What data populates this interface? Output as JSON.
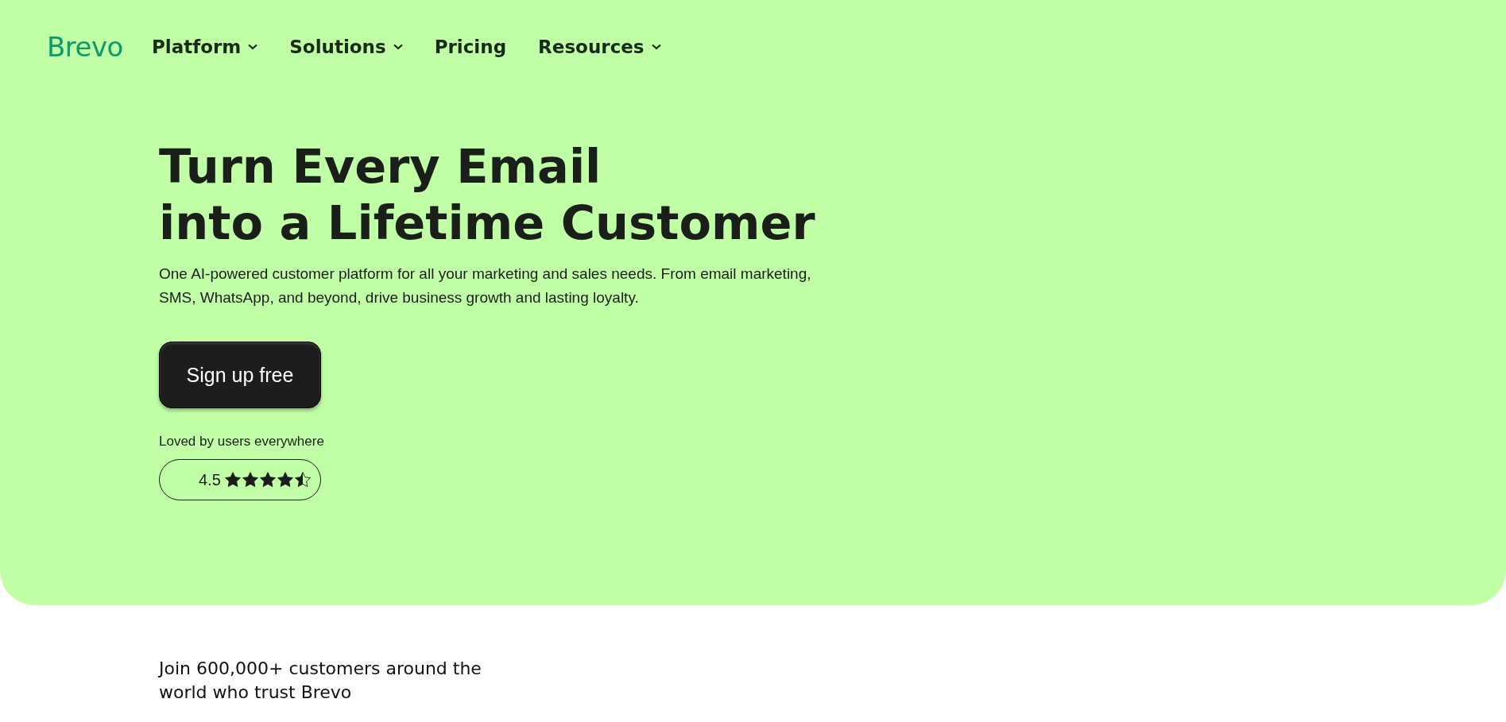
{
  "logo": "Brevo",
  "nav": [
    {
      "label": "Platform",
      "dropdown": true
    },
    {
      "label": "Solutions",
      "dropdown": true
    },
    {
      "label": "Pricing",
      "dropdown": false
    },
    {
      "label": "Resources",
      "dropdown": true
    }
  ],
  "hero": {
    "title_lines": [
      "Turn Every Email",
      "into a Lifetime Customer"
    ],
    "subtitle": "One AI-powered customer platform for all your marketing and sales needs. From email marketing, SMS, WhatsApp, and beyond, drive business growth and lasting loyalty.",
    "cta": "Sign up free",
    "rating_label": "Loved by users everywhere",
    "rating": {
      "score": "4.5",
      "stars": 4.5
    }
  },
  "trust_text": "Join 600,000+ customers around the world who trust Brevo"
}
